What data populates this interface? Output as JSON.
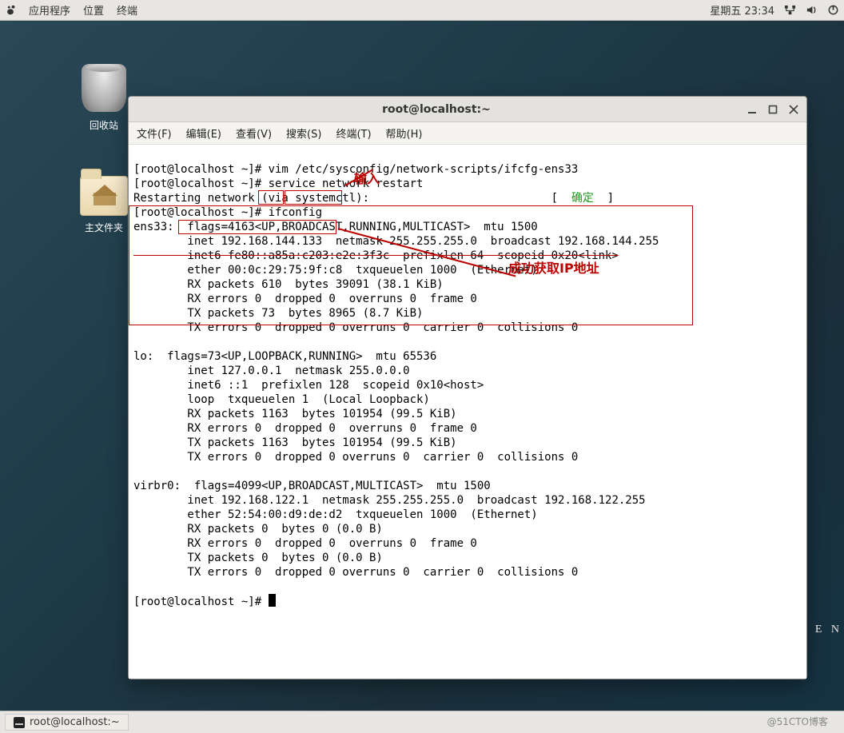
{
  "topbar": {
    "apps": "应用程序",
    "places": "位置",
    "terminal": "终端",
    "datetime": "星期五 23:34"
  },
  "desktop": {
    "trash_label": "回收站",
    "home_label": "主文件夹"
  },
  "window": {
    "title": "root@localhost:~",
    "menus": {
      "file": "文件(F)",
      "edit": "编辑(E)",
      "view": "查看(V)",
      "search": "搜索(S)",
      "terminal": "终端(T)",
      "help": "帮助(H)"
    }
  },
  "term": {
    "l1": "[root@localhost ~]# vim /etc/sysconfig/network-scripts/ifcfg-ens33",
    "l2": "[root@localhost ~]# service network restart",
    "l3a": "Restarting network (via systemctl):",
    "l3b": "[  ",
    "l3ok": "确定",
    "l3c": "  ]",
    "l4a": "[root@localhost ~]# ",
    "l4b": "ifconfig",
    "l5": "ens33:  flags=4163<UP,BROADCAST,RUNNING,MULTICAST>  mtu 1500",
    "l6a": "        inet 192.168.144.133",
    "l6b": "  netmask 255.255.255.0  broadcast 192.168.144.255",
    "l7": "        inet6 fe80::a85a:c203:e2e:3f3c  prefixlen 64  scopeid 0x20<link>",
    "l8": "        ether 00:0c:29:75:9f:c8  txqueuelen 1000  (Ethernet)",
    "l9": "        RX packets 610  bytes 39091 (38.1 KiB)",
    "l10": "        RX errors 0  dropped 0  overruns 0  frame 0",
    "l11": "        TX packets 73  bytes 8965 (8.7 KiB)",
    "l12": "        TX errors 0  dropped 0 overruns 0  carrier 0  collisions 0",
    "lo1": "lo:  flags=73<UP,LOOPBACK,RUNNING>  mtu 65536",
    "lo2": "        inet 127.0.0.1  netmask 255.0.0.0",
    "lo3": "        inet6 ::1  prefixlen 128  scopeid 0x10<host>",
    "lo4": "        loop  txqueuelen 1  (Local Loopback)",
    "lo5": "        RX packets 1163  bytes 101954 (99.5 KiB)",
    "lo6": "        RX errors 0  dropped 0  overruns 0  frame 0",
    "lo7": "        TX packets 1163  bytes 101954 (99.5 KiB)",
    "lo8": "        TX errors 0  dropped 0 overruns 0  carrier 0  collisions 0",
    "vb1": "virbr0:  flags=4099<UP,BROADCAST,MULTICAST>  mtu 1500",
    "vb2": "        inet 192.168.122.1  netmask 255.255.255.0  broadcast 192.168.122.255",
    "vb3": "        ether 52:54:00:d9:de:d2  txqueuelen 1000  (Ethernet)",
    "vb4": "        RX packets 0  bytes 0 (0.0 B)",
    "vb5": "        RX errors 0  dropped 0  overruns 0  frame 0",
    "vb6": "        TX packets 0  bytes 0 (0.0 B)",
    "vb7": "        TX errors 0  dropped 0 overruns 0  carrier 0  collisions 0",
    "prompt": "[root@localhost ~]# "
  },
  "anno": {
    "input_label": "输入",
    "ip_label": "成功获取IP地址"
  },
  "taskbar": {
    "item1": "root@localhost:~"
  },
  "watermark": "@51CTO博客",
  "side_frag": "E N"
}
